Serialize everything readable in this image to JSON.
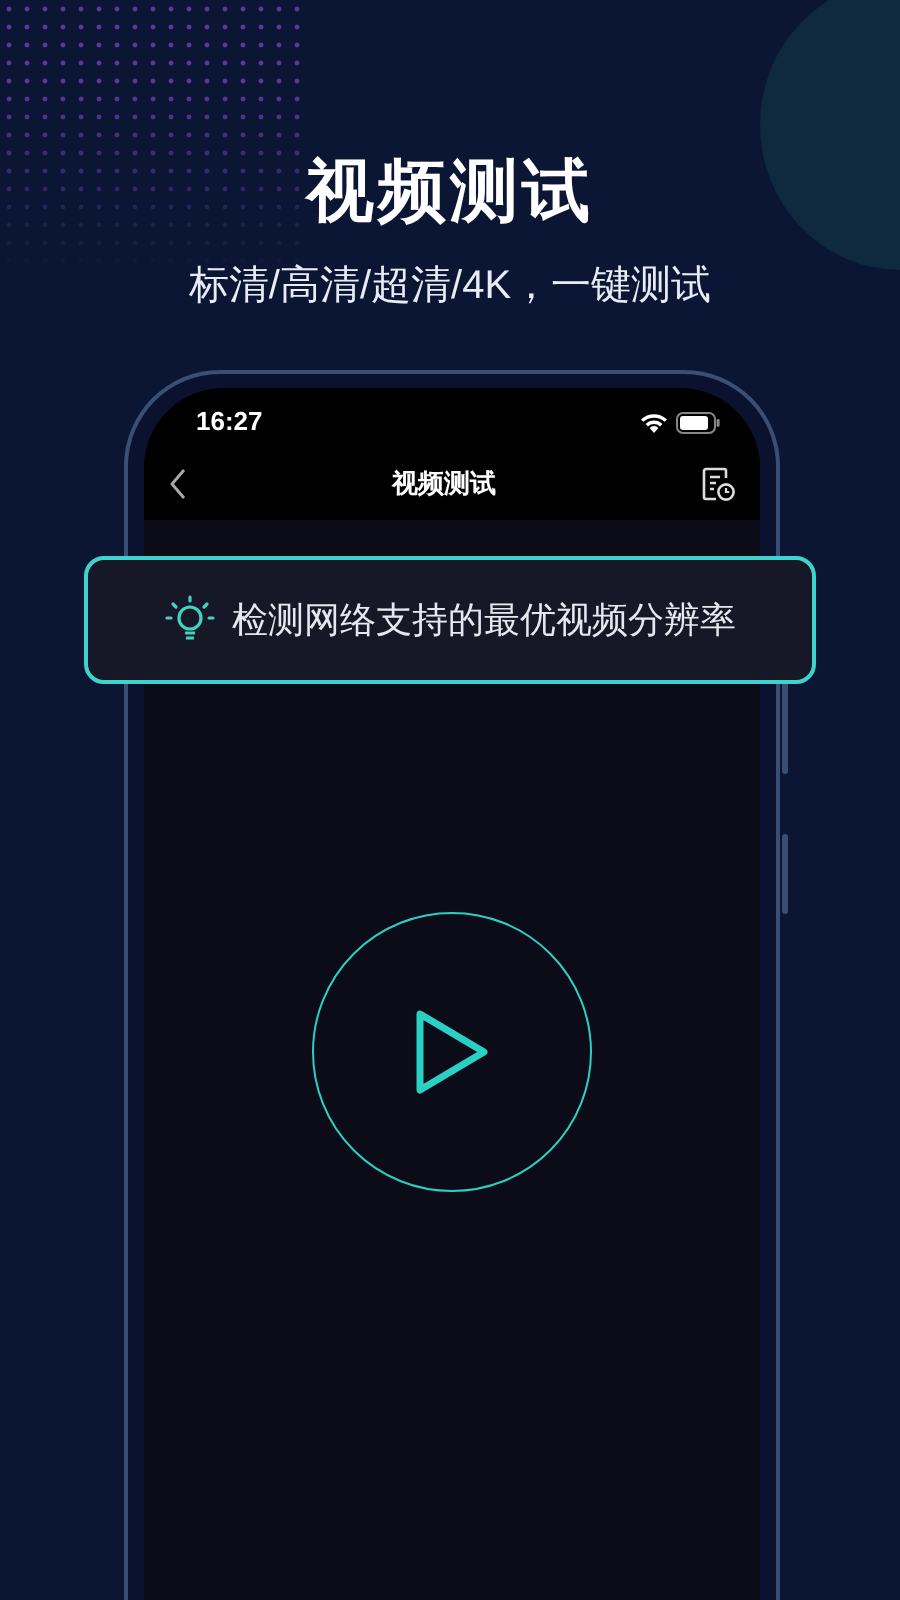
{
  "header": {
    "title": "视频测试",
    "subtitle": "标清/高清/超清/4K，一键测试"
  },
  "phone": {
    "status_bar": {
      "time": "16:27"
    },
    "nav_bar": {
      "title": "视频测试"
    }
  },
  "tip": {
    "text": "检测网络支持的最优视频分辨率"
  }
}
